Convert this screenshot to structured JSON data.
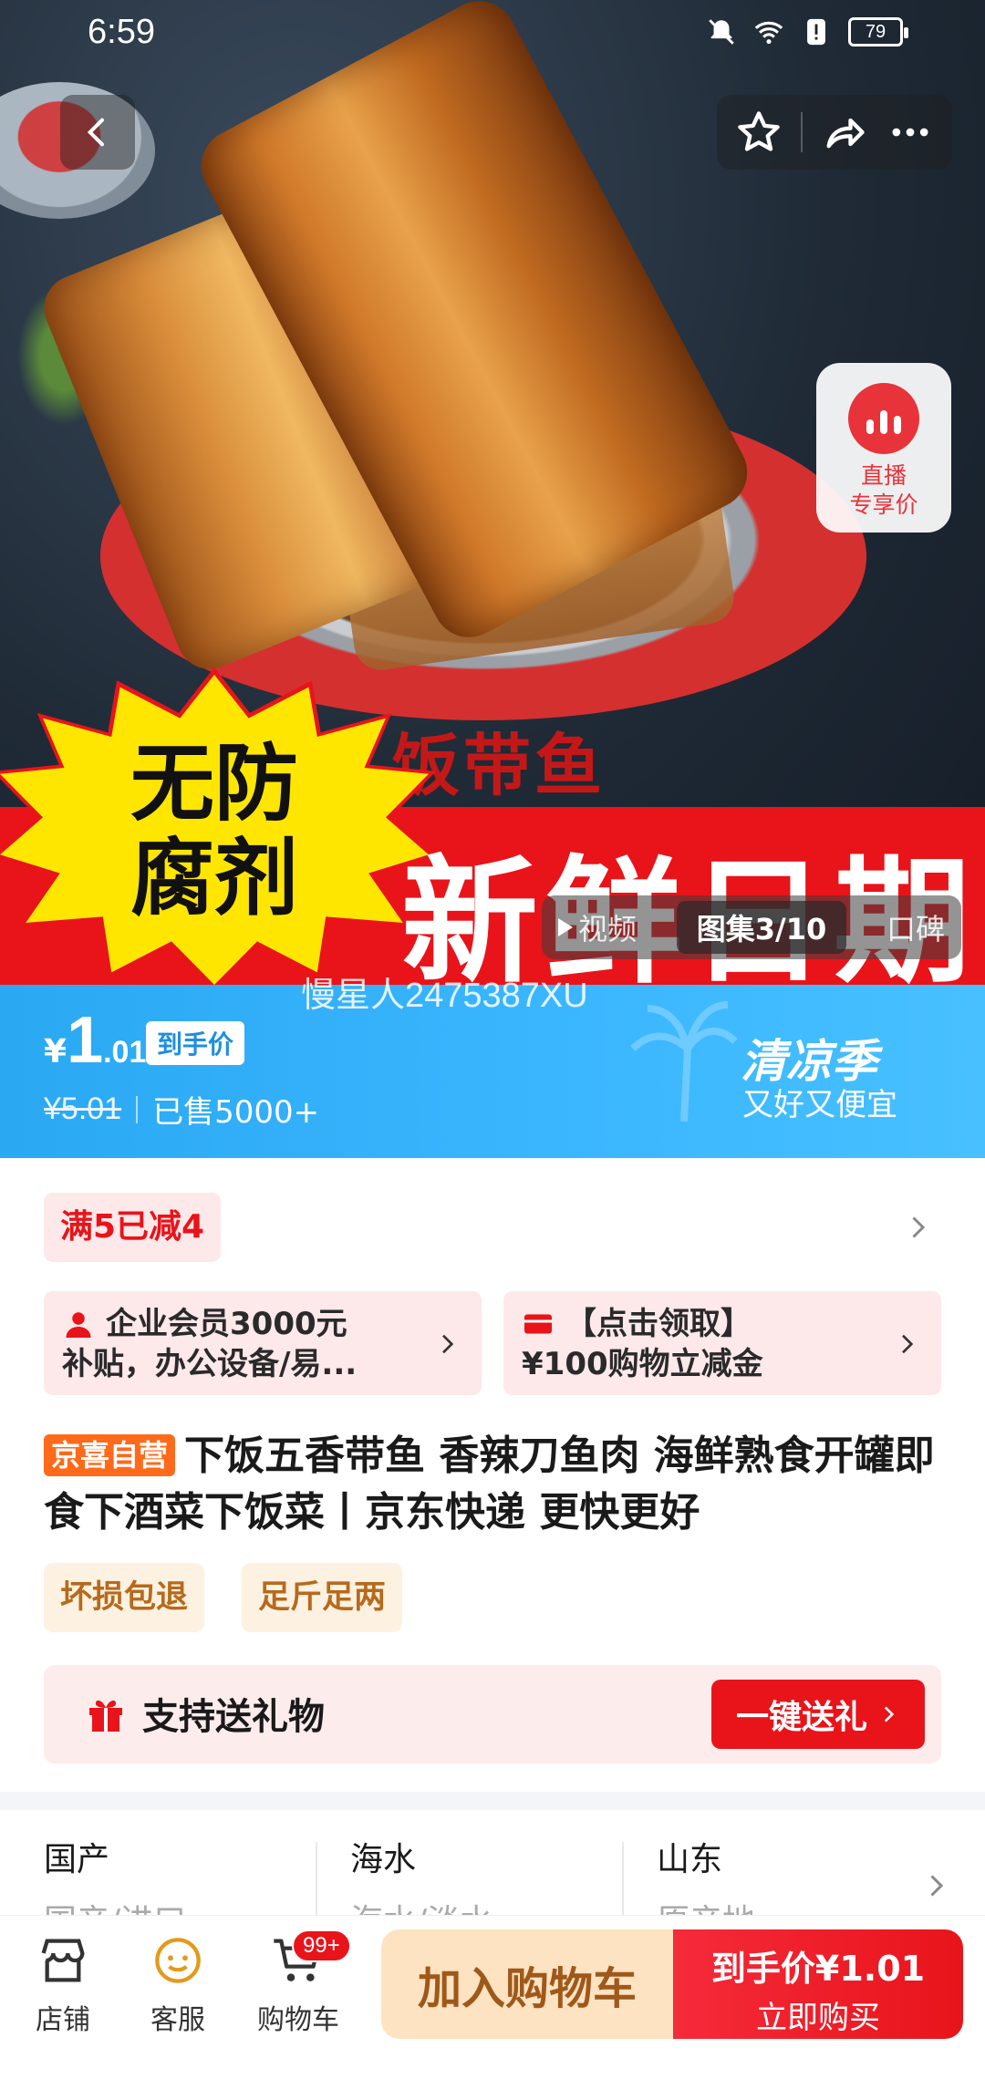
{
  "status": {
    "time": "6:59",
    "battery": "79"
  },
  "hero": {
    "burst_text": "无防腐剂",
    "banner_text": "新鲜日期",
    "can_text": "饭带鱼"
  },
  "media_tabs": [
    {
      "label": "视频"
    },
    {
      "label": "图集3/10"
    },
    {
      "label": "口碑"
    }
  ],
  "live": {
    "line1": "直播",
    "line2": "专享价"
  },
  "watermark": "慢星人2475387XU",
  "price": {
    "yen": "¥",
    "int": "1",
    "dec": ".01",
    "tag": "到手价",
    "original": "¥5.01",
    "sold": "已售5000+",
    "season_title": "清凉季",
    "season_sub": "又好又便宜"
  },
  "promo": {
    "badge": "满5已减4"
  },
  "coupons": [
    {
      "line1": "企业会员3000元",
      "line2": "补贴，办公设备/易..."
    },
    {
      "line1": "【点击领取】",
      "line2": "¥100购物立减金"
    }
  ],
  "product": {
    "self_tag": "京喜自营",
    "title": "下饭五香带鱼 香辣刀鱼肉 海鲜熟食开罐即食下酒菜下饭菜丨京东快递 更快更好",
    "tags": [
      "坏损包退",
      "足斤足两"
    ]
  },
  "gift": {
    "label": "支持送礼物",
    "button": "一键送礼"
  },
  "specs": [
    {
      "key": "国产",
      "value": "国产/进口"
    },
    {
      "key": "海水",
      "value": "海水/淡水"
    },
    {
      "key": "山东",
      "value": "原产地"
    }
  ],
  "bottom": {
    "store": "店铺",
    "service": "客服",
    "cart": "购物车",
    "cart_badge": "99+",
    "add_cart": "加入购物车",
    "buy_top": "到手价¥1.01",
    "buy_bottom": "立即购买"
  },
  "colors": {
    "accent": "#e8141a",
    "price_bar": "#3bb7ff",
    "self_tag": "#ff6a1a"
  }
}
